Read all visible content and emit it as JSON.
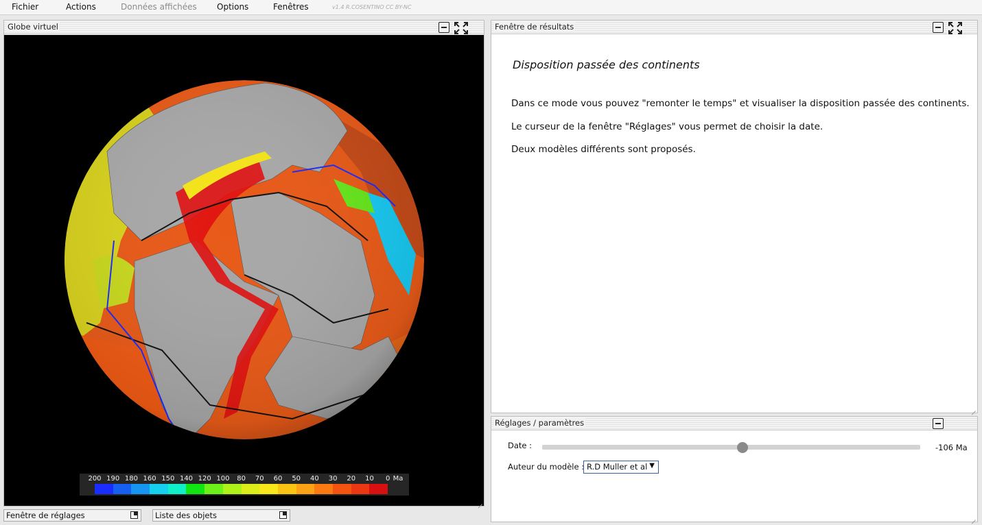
{
  "menu": {
    "items": [
      {
        "label": "Fichier",
        "enabled": true
      },
      {
        "label": "Actions",
        "enabled": true
      },
      {
        "label": "Données affichées",
        "enabled": false
      },
      {
        "label": "Options",
        "enabled": true
      },
      {
        "label": "Fenêtres",
        "enabled": true
      }
    ],
    "version": "v1.4 R.COSENTINO CC BY-NC"
  },
  "globe_panel": {
    "title": "Globe virtuel",
    "legend": {
      "labels": [
        "200",
        "190",
        "180",
        "160",
        "150",
        "140",
        "120",
        "100",
        "80",
        "70",
        "60",
        "50",
        "40",
        "30",
        "20",
        "10",
        "0"
      ],
      "unit": "Ma",
      "colors": [
        "#1a2cff",
        "#1560f0",
        "#1696f2",
        "#16d0f0",
        "#10f0c8",
        "#12e612",
        "#6cf218",
        "#aef21a",
        "#dcee1a",
        "#f8e81a",
        "#fcc412",
        "#fca214",
        "#fc7a12",
        "#f45410",
        "#ec3812",
        "#d81010"
      ]
    }
  },
  "results_panel": {
    "title": "Fenêtre de résultats",
    "heading": "Disposition passée des continents",
    "paragraphs": [
      "Dans ce mode vous pouvez \"remonter le temps\" et visualiser la disposition passée des continents.",
      "Le curseur de la fenêtre \"Réglages\" vous permet de choisir la date.",
      "Deux modèles différents sont proposés."
    ]
  },
  "settings_panel": {
    "title": "Réglages / paramètres",
    "date_label": "Date :",
    "date_value": "-106 Ma",
    "date_slider_fraction": 0.53,
    "model_label": "Auteur du modèle :",
    "model_selected": "R.D Muller et al"
  },
  "minimized_windows": [
    {
      "label": "Fenêtre de réglages"
    },
    {
      "label": "Liste des objets"
    }
  ]
}
